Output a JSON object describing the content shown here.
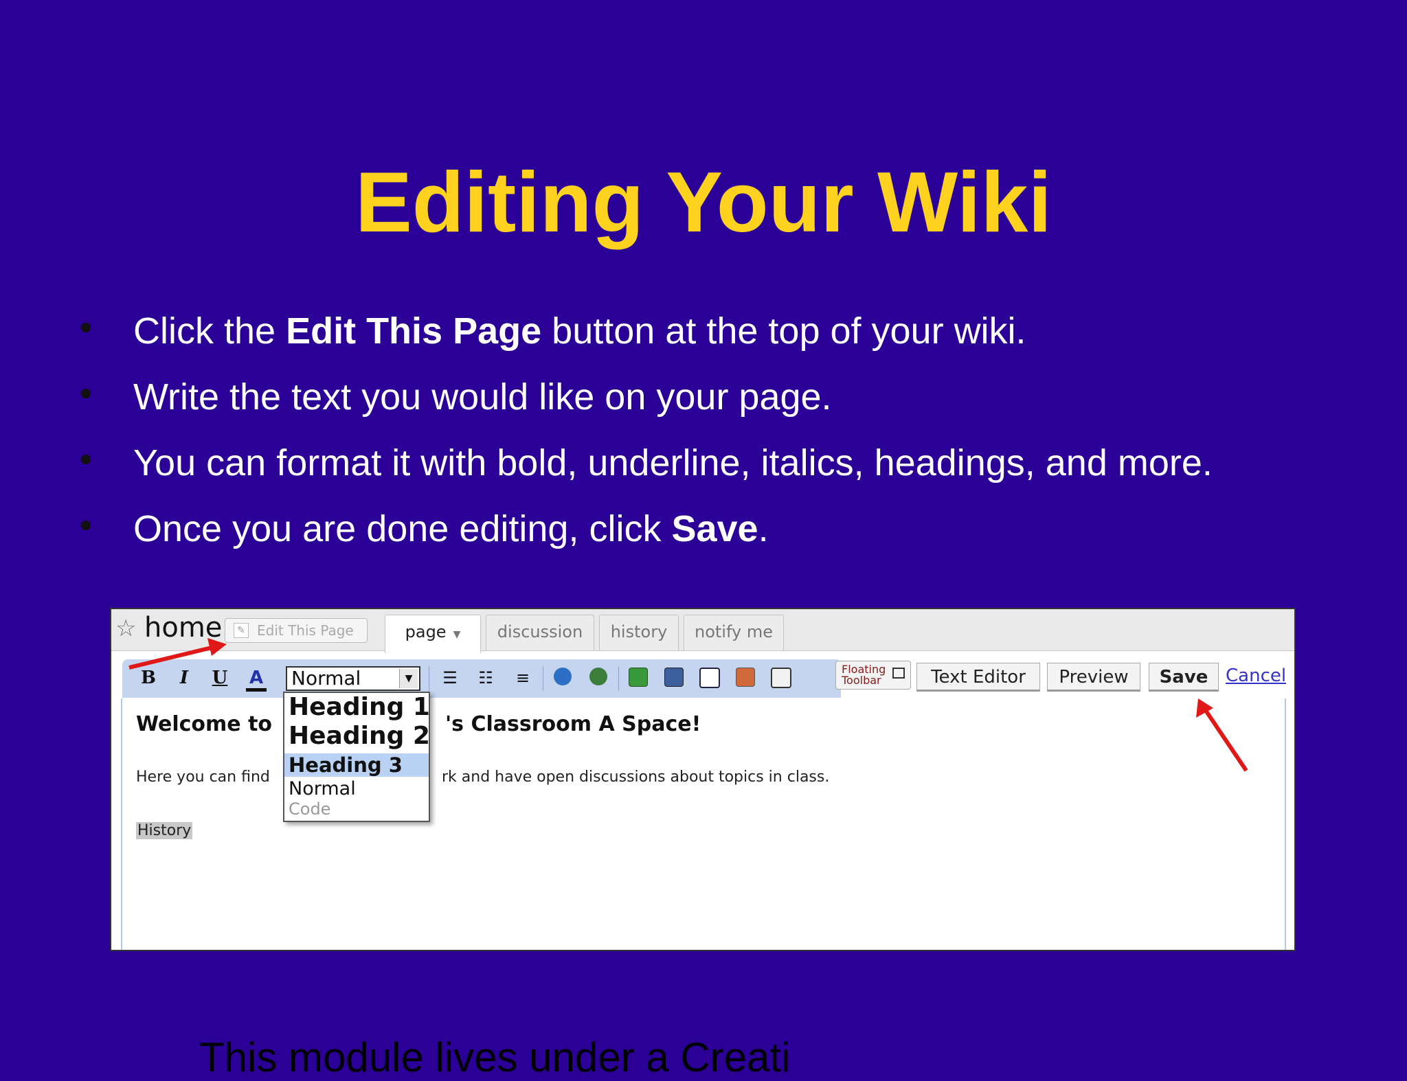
{
  "slide": {
    "title": "Editing Your Wiki",
    "bullets": [
      {
        "pre": "Click the ",
        "bold": "Edit This Page",
        "post": " button at the top of your wiki."
      },
      {
        "pre": "Write the text you would like on your page.",
        "bold": "",
        "post": ""
      },
      {
        "pre": "You can format it with bold, underline, italics, headings, and more.",
        "bold": "",
        "post": ""
      },
      {
        "pre": "Once you are done editing, click ",
        "bold": "Save",
        "post": "."
      }
    ],
    "footer_partial": "This module lives under a Creati"
  },
  "wiki": {
    "page_title": "home",
    "edit_button": "Edit This Page",
    "tabs": [
      {
        "label": "page",
        "active": true
      },
      {
        "label": "discussion",
        "active": false
      },
      {
        "label": "history",
        "active": false
      },
      {
        "label": "notify me",
        "active": false
      }
    ],
    "toolbar": {
      "bold": "B",
      "italic": "I",
      "underline": "U",
      "color": "A",
      "format_value": "Normal",
      "floating_line1": "Floating",
      "floating_line2": "Toolbar",
      "text_editor": "Text Editor",
      "preview": "Preview",
      "save": "Save",
      "cancel": "Cancel"
    },
    "format_options": [
      "Heading 1",
      "Heading 2",
      "Heading 3",
      "Normal",
      "Code"
    ],
    "highlighted_option": "Heading 3",
    "editor": {
      "heading_start": "Welcome to",
      "heading_end": "'s Classroom A Space!",
      "para_start": "Here you can find",
      "para_end": "rk and have open discussions about topics in class.",
      "link": "History"
    }
  },
  "colors": {
    "background": "#2a0096",
    "title": "#ffd21f",
    "arrow": "#e01818"
  }
}
